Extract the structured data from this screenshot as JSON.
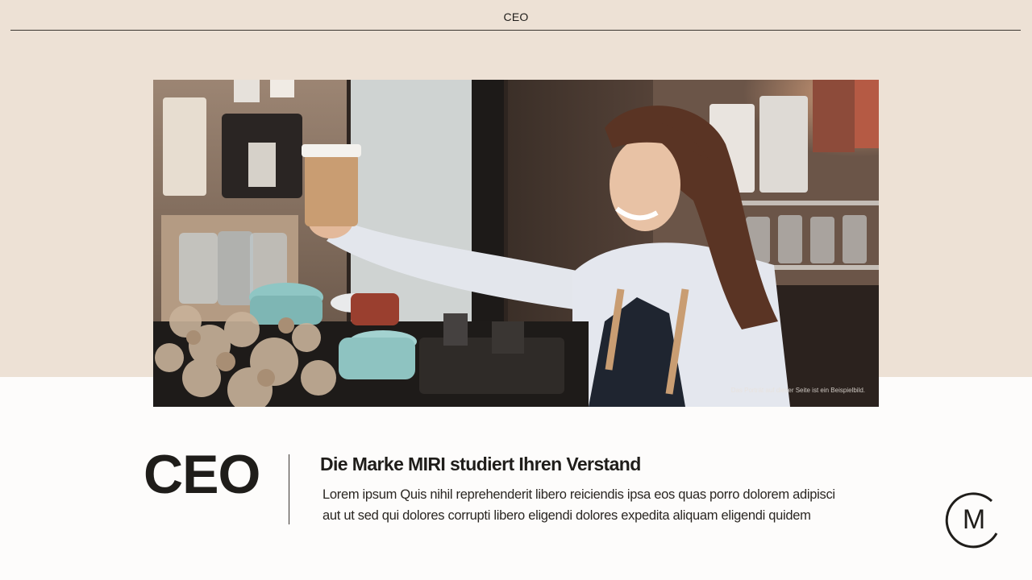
{
  "header": {
    "title": "CEO"
  },
  "photo": {
    "caption": "Das Porträt auf dieser Seite ist ein Beispielbild."
  },
  "profile": {
    "role_title": "CEO",
    "subheading": "Die Marke MIRI studiert Ihren Verstand",
    "body_line_1": "Lorem ipsum Quis nihil reprehenderit libero reiciendis ipsa eos quas porro dolorem adipisci",
    "body_line_2": "aut ut sed qui dolores corrupti libero eligendi dolores expedita aliquam eligendi quidem"
  },
  "brand": {
    "logo_letter": "M"
  },
  "colors": {
    "top_band": "#ede1d5",
    "page_background": "#fdfcfb",
    "text": "#1f1d1a",
    "accent_tan": "#c9a27a"
  },
  "icons": {
    "logo": "m-circle-logo-icon"
  }
}
